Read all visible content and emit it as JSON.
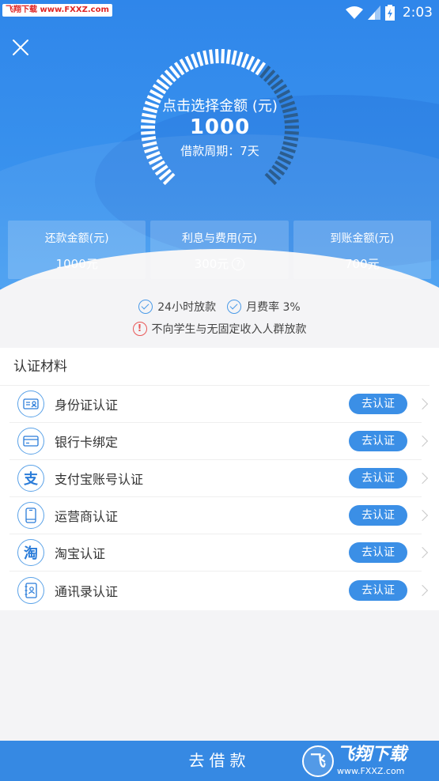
{
  "status_bar": {
    "watermark": "飞翔下载 www.FXXZ.com",
    "time": "2:03"
  },
  "gauge": {
    "label": "点击选择金额 (元)",
    "amount": "1000",
    "period": "借款周期：7天"
  },
  "stats": [
    {
      "label": "还款金额(元)",
      "value": "1000元"
    },
    {
      "label": "利息与费用(元)",
      "value": "300元",
      "has_help": true
    },
    {
      "label": "到账金额(元)",
      "value": "700元"
    }
  ],
  "notes": {
    "fast_payout": "24小时放款",
    "monthly_rate": "月费率 3%",
    "warning": "不向学生与无固定收入人群放款"
  },
  "certification": {
    "title": "认证材料",
    "items": [
      {
        "label": "身份证认证",
        "icon": "id-card-icon",
        "button": "去认证"
      },
      {
        "label": "银行卡绑定",
        "icon": "bank-card-icon",
        "button": "去认证"
      },
      {
        "label": "支付宝账号认证",
        "icon": "alipay-icon",
        "icon_text": "支",
        "button": "去认证"
      },
      {
        "label": "运营商认证",
        "icon": "phone-icon",
        "button": "去认证"
      },
      {
        "label": "淘宝认证",
        "icon": "taobao-icon",
        "icon_text": "淘",
        "button": "去认证"
      },
      {
        "label": "通讯录认证",
        "icon": "contacts-icon",
        "button": "去认证"
      }
    ]
  },
  "footer": {
    "button": "去借款",
    "watermark_logo": "飞",
    "watermark_title": "飞翔下载",
    "watermark_url": "www.FXXZ.com"
  },
  "colors": {
    "primary": "#3689e3",
    "accent_button": "#3b8fe6",
    "warning": "#e95757"
  }
}
